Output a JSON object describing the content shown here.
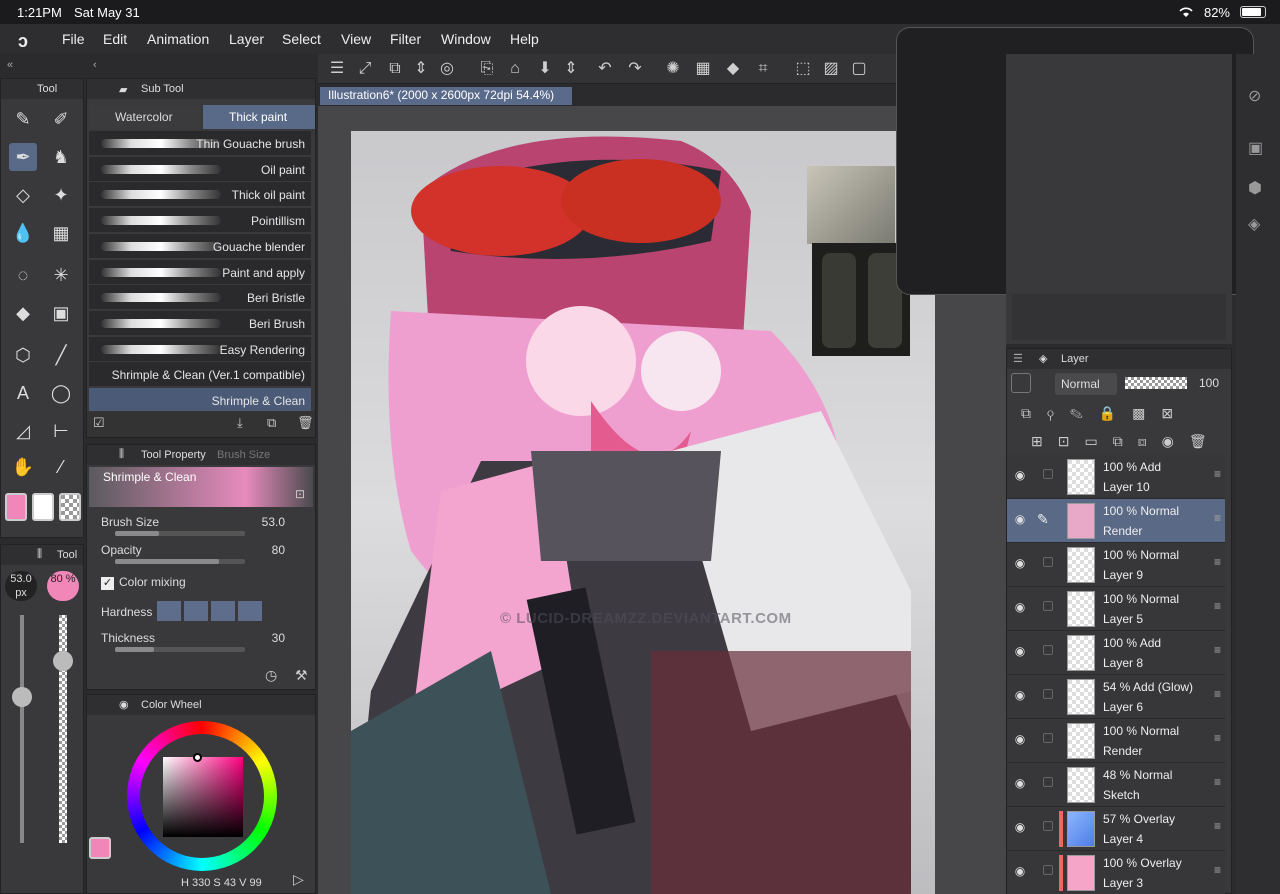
{
  "status": {
    "time": "1:21PM",
    "date": "Sat May 31",
    "battery": "82%"
  },
  "menu": [
    "File",
    "Edit",
    "Animation",
    "Layer",
    "Select",
    "View",
    "Filter",
    "Window",
    "Help"
  ],
  "doc": {
    "title": "Illustration6* (2000 x 2600px 72dpi 54.4%)"
  },
  "toolpanel": {
    "title": "Tool"
  },
  "subtool": {
    "title": "Sub Tool",
    "tabs": [
      "Watercolor",
      "Thick paint"
    ],
    "brushes": [
      "Thin Gouache brush",
      "Oil paint",
      "Thick oil paint",
      "Pointillism",
      "Gouache blender",
      "Paint and apply",
      "Beri Bristle",
      "Beri Brush",
      "Easy Rendering",
      "Shrimple & Clean (Ver.1 compatible)",
      "Shrimple & Clean"
    ]
  },
  "toolprop": {
    "title": "Tool Property",
    "tab2": "Brush Size",
    "brush": "Shrimple & Clean",
    "rows": [
      {
        "label": "Brush Size",
        "value": "53.0"
      },
      {
        "label": "Opacity",
        "value": "80"
      },
      {
        "label": "Color mixing",
        "value": ""
      },
      {
        "label": "Hardness",
        "value": ""
      },
      {
        "label": "Thickness",
        "value": "30"
      }
    ]
  },
  "sizepanel": {
    "title": "Tool",
    "size": "53.0 px",
    "opacity": "80 %"
  },
  "colorpanel": {
    "title": "Color Wheel",
    "h": "330",
    "s": "43",
    "v": "99"
  },
  "watermark": "© LUCID-DREAMZZ.DEVIANTART.COM",
  "layers": {
    "title": "Layer",
    "blend": "Normal",
    "opacity": "100",
    "items": [
      {
        "line1": "100 % Add",
        "name": "Layer 10"
      },
      {
        "line1": "100 % Normal",
        "name": "Render"
      },
      {
        "line1": "100 % Normal",
        "name": "Layer 9"
      },
      {
        "line1": "100 % Normal",
        "name": "Layer 5"
      },
      {
        "line1": "100 % Add",
        "name": "Layer 8"
      },
      {
        "line1": "54 % Add (Glow)",
        "name": "Layer 6"
      },
      {
        "line1": "100 % Normal",
        "name": "Render"
      },
      {
        "line1": "48 % Normal",
        "name": "Sketch"
      },
      {
        "line1": "57 % Overlay",
        "name": "Layer 4"
      },
      {
        "line1": "100 % Overlay",
        "name": "Layer 3"
      }
    ]
  },
  "colors": {
    "main": "#f087b8",
    "accent": "#5a6a8b"
  }
}
